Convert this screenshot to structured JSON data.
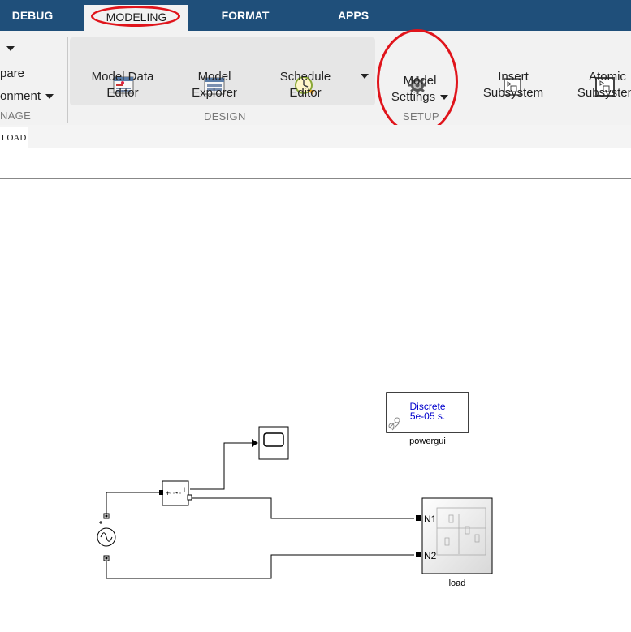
{
  "tabs": [
    "DEBUG",
    "MODELING",
    "FORMAT",
    "APPS"
  ],
  "manage": {
    "item1": "pare",
    "item2": "onment",
    "label": "NAGE"
  },
  "design": {
    "buttons": [
      {
        "line1": "Model Data",
        "line2": "Editor"
      },
      {
        "line1": "Model",
        "line2": "Explorer"
      },
      {
        "line1": "Schedule",
        "line2": "Editor"
      }
    ],
    "label": "DESIGN"
  },
  "setup": {
    "button": {
      "line1": "Model",
      "line2": "Settings"
    },
    "label": "SETUP"
  },
  "subsystem": {
    "buttons": [
      {
        "line1": "Insert",
        "line2": "Subsystem"
      },
      {
        "line1": "Atomic",
        "line2": "Subsystem"
      }
    ]
  },
  "breadcrumb": "LOAD",
  "model": {
    "powergui": {
      "line1": "Discrete",
      "line2": "5e-05 s.",
      "name": "powergui"
    },
    "load": {
      "name": "load",
      "port1": "N1",
      "port2": "N2"
    },
    "meter": {
      "plus": "+",
      "minus": "-",
      "out": "i"
    }
  },
  "colors": {
    "tabbar": "#1f4f7a",
    "highlight": "#e0141b",
    "powergui_text": "#0000cc"
  }
}
